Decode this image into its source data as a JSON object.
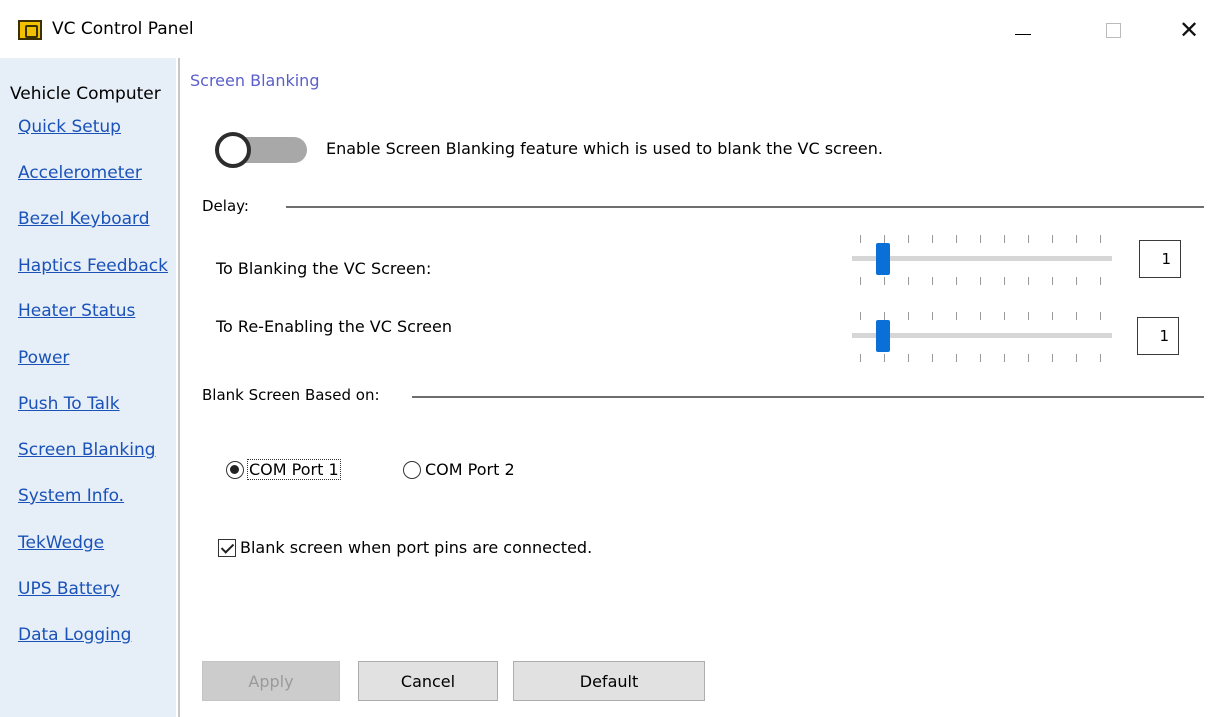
{
  "window": {
    "title": "VC Control Panel",
    "icon": "vc-control-panel-icon",
    "controls": {
      "minimize": "minimize-icon",
      "maximize": "maximize-icon",
      "close": "close-icon"
    },
    "close_glyph": "✕"
  },
  "sidebar": {
    "heading": "Vehicle Computer",
    "items": [
      {
        "label": "Quick Setup"
      },
      {
        "label": "Accelerometer"
      },
      {
        "label": "Bezel Keyboard"
      },
      {
        "label": "Haptics Feedback"
      },
      {
        "label": "Heater Status"
      },
      {
        "label": "Power"
      },
      {
        "label": "Push To Talk"
      },
      {
        "label": "Screen Blanking"
      },
      {
        "label": "System Info."
      },
      {
        "label": "TekWedge"
      },
      {
        "label": "UPS Battery"
      },
      {
        "label": "Data Logging"
      }
    ]
  },
  "main": {
    "section_title": "Screen Blanking",
    "enable_toggle": {
      "label": "Enable Screen Blanking feature which is used to blank the VC screen.",
      "state": "off"
    },
    "delay": {
      "group_label": "Delay:",
      "blanking": {
        "label": "To Blanking the VC Screen:",
        "value": "1",
        "slider_level": 1
      },
      "reenabling": {
        "label": "To Re-Enabling the VC Screen",
        "value": "1",
        "slider_level": 1
      }
    },
    "blank_based_on": {
      "group_label": "Blank Screen Based on:",
      "options": [
        {
          "label": "COM Port 1",
          "selected": true
        },
        {
          "label": "COM Port 2",
          "selected": false
        }
      ]
    },
    "checkbox": {
      "label": "Blank screen when port pins are connected.",
      "checked": true
    }
  },
  "buttons": {
    "apply": "Apply",
    "cancel": "Cancel",
    "default": "Default"
  },
  "colors": {
    "sidebar_bg": "#e6eef8",
    "link": "#1a52b8",
    "section_title": "#5a5fc9",
    "slider_thumb": "#0a6fd6",
    "app_icon": "#f2c200"
  }
}
